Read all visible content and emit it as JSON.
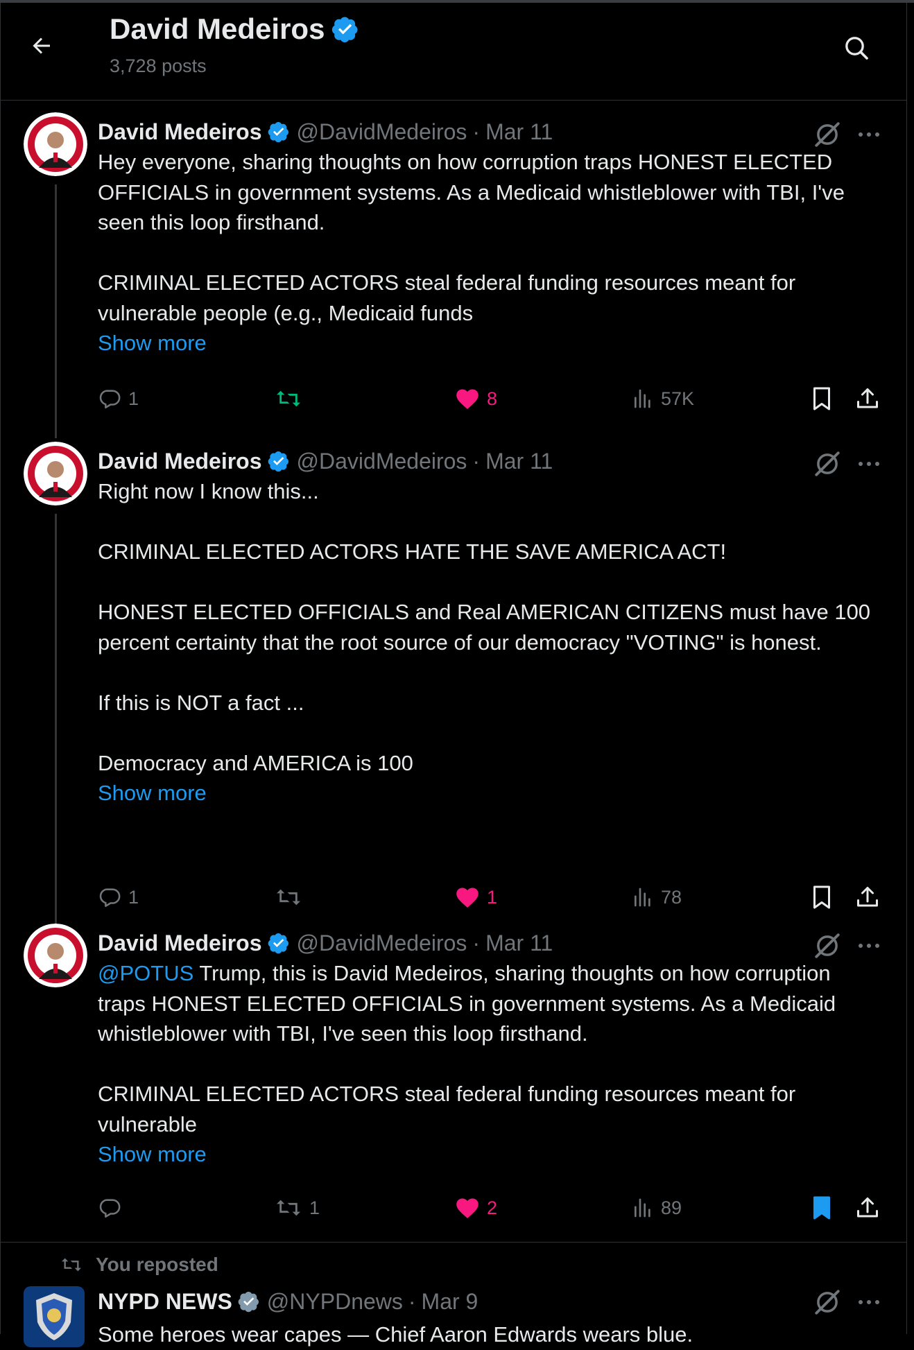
{
  "header": {
    "title": "David Medeiros",
    "post_count": "3,728 posts"
  },
  "posts": [
    {
      "name": "David Medeiros",
      "handle": "@DavidMedeiros",
      "separator": "·",
      "date": "Mar 11",
      "text_1": "Hey everyone, sharing thoughts on how corruption traps HONEST ELECTED OFFICIALS in government systems. As a Medicaid whistleblower with TBI, I've seen this loop firsthand.\n\nCRIMINAL ELECTED ACTORS steal federal funding resources meant for vulnerable people (e.g., Medicaid funds",
      "show_more": "Show more",
      "replies": "1",
      "reposts": "",
      "likes": "8",
      "views": "57K",
      "reposted": true,
      "bookmarked": false
    },
    {
      "name": "David Medeiros",
      "handle": "@DavidMedeiros",
      "separator": "·",
      "date": "Mar 11",
      "text_1": "Right now I know this...\n\nCRIMINAL ELECTED ACTORS HATE THE SAVE AMERICA ACT!\n\nHONEST ELECTED OFFICIALS and Real AMERICAN CITIZENS must have 100 percent certainty that the root source of our democracy \"VOTING\" is honest.\n\nIf this is NOT a fact ...\n\nDemocracy and AMERICA is 100",
      "show_more": "Show more",
      "replies": "1",
      "reposts": "",
      "likes": "1",
      "views": "78",
      "reposted": false,
      "bookmarked": false
    },
    {
      "name": "David Medeiros",
      "handle": "@DavidMedeiros",
      "separator": "·",
      "date": "Mar 11",
      "mention": "@POTUS",
      "text_1": " Trump, this is David Medeiros, sharing thoughts on how corruption traps HONEST ELECTED OFFICIALS in government systems. As a Medicaid whistleblower with TBI, I've seen this loop firsthand.\n\nCRIMINAL ELECTED ACTORS steal federal funding resources meant for vulnerable",
      "show_more": "Show more",
      "replies": "",
      "reposts": "1",
      "likes": "2",
      "views": "89",
      "reposted": false,
      "bookmarked": true
    }
  ],
  "repost": {
    "label": "You reposted",
    "name": "NYPD NEWS",
    "handle": "@NYPDnews",
    "separator": "·",
    "date": "Mar 9",
    "text": "Some heroes wear capes — Chief Aaron Edwards wears blue."
  },
  "colors": {
    "accent": "#1d9bf0",
    "like": "#f91880",
    "repost": "#00ba7c",
    "muted": "#71767b",
    "text": "#e7e9ea",
    "background": "#000000"
  },
  "icons": [
    "back-arrow-icon",
    "verified-badge-icon",
    "search-icon",
    "grok-icon",
    "more-icon",
    "reply-icon",
    "repost-icon",
    "heart-icon",
    "views-icon",
    "bookmark-icon",
    "share-icon"
  ]
}
